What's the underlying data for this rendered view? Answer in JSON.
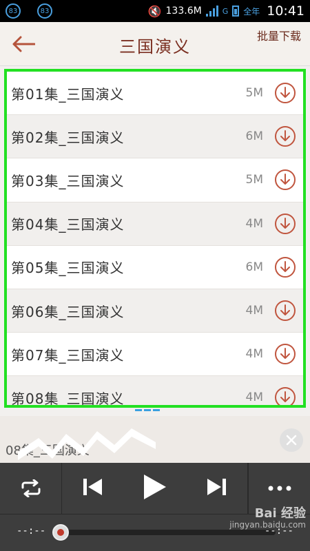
{
  "status_bar": {
    "badge_left_1": "83",
    "badge_left_2": "83",
    "speed": "133.6M",
    "network": "G",
    "carrier": "全年",
    "time": "10:41"
  },
  "header": {
    "title": "三国演义",
    "batch_download": "批量下载"
  },
  "episodes": [
    {
      "title": "第01集_三国演义",
      "size": "5M"
    },
    {
      "title": "第02集_三国演义",
      "size": "6M"
    },
    {
      "title": "第03集_三国演义",
      "size": "5M"
    },
    {
      "title": "第04集_三国演义",
      "size": "4M"
    },
    {
      "title": "第05集_三国演义",
      "size": "6M"
    },
    {
      "title": "第06集_三国演义",
      "size": "4M"
    },
    {
      "title": "第07集_三国演义",
      "size": "4M"
    },
    {
      "title": "第08集_三国演义",
      "size": "4M"
    }
  ],
  "now_playing": {
    "title": "08集_三国演义"
  },
  "player": {
    "time_start": "--:--",
    "time_end": "--:--",
    "progress": 0
  },
  "watermark": {
    "brand": "Bai 经验",
    "url": "jingyan.baidu.com"
  },
  "colors": {
    "accent": "#c0553e",
    "highlight": "#22e022",
    "player_bg": "#3d3d3d"
  }
}
